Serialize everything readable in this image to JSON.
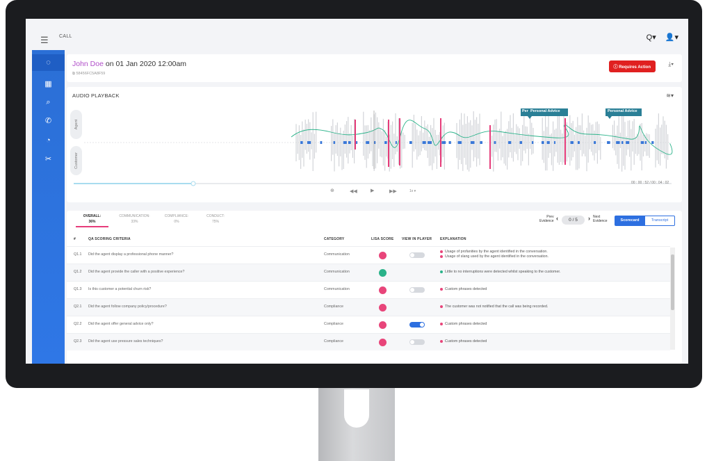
{
  "topbar": {
    "breadcrumb": "CALL",
    "menu_icon": "☰",
    "search_icon": "Q▾",
    "user_icon": "👤▾"
  },
  "sidebar": {
    "items": [
      {
        "icon": "chat-icon",
        "glyph": "◌"
      },
      {
        "icon": "dashboard-icon",
        "glyph": "▦"
      },
      {
        "icon": "search-icon",
        "glyph": "⌕"
      },
      {
        "icon": "phone-icon",
        "glyph": "✆"
      },
      {
        "icon": "pie-chart-icon",
        "glyph": "◔"
      },
      {
        "icon": "tools-icon",
        "glyph": "✂"
      }
    ]
  },
  "header": {
    "caller_name": "John Doe",
    "title_suffix": " on 01 Jan 2020 12:00am",
    "call_id": "58456FC5A8F59",
    "requires_action": "ⓘ Requires Action",
    "download_icon": "⤓▾"
  },
  "audio": {
    "title": "AUDIO PLAYBACK",
    "agent_label": "Agent",
    "customer_label": "Customer",
    "tooltip_short": "Per",
    "tooltip_1": "Personal Advice",
    "tooltip_2": "Personal Advice",
    "time": "00 : 00 : 52 / 00 : 04 : 02",
    "speed": "1x ▾",
    "progress": 0.2,
    "accent_color": "#e63c7a",
    "line_color": "#2bb38a"
  },
  "scorecard": {
    "tabs": [
      {
        "name": "OVERALL:",
        "value": "36%"
      },
      {
        "name": "COMMUNICATION:",
        "value": "33%"
      },
      {
        "name": "COMPLIANCE:",
        "value": "0%"
      },
      {
        "name": "CONDUCT:",
        "value": "75%"
      }
    ],
    "prev": "Prev",
    "next": "Next",
    "evidence": "Evidence",
    "evidence_count": "0 / 5",
    "btn_scorecard": "Scorecard",
    "btn_transcript": "Transcript",
    "headers": {
      "num": "#",
      "criteria": "QA SCORING CRITERIA",
      "category": "CATEGORY",
      "score": "LISA SCORE",
      "view": "VIEW IN PLAYER",
      "explanation": "EXPLANATION"
    },
    "rows": [
      {
        "id": "Q1.1",
        "criteria": "Did the agent display a professional phone manner?",
        "category": "Communication",
        "score": "fail",
        "toggle": "off",
        "explanation": [
          "Usage of profanities by the agent identified in the conversation.",
          "Usage of slang used by the agent identified in the conversation."
        ],
        "exp_status": [
          "fail",
          "fail"
        ]
      },
      {
        "id": "Q1.2",
        "criteria": "Did the agent provide the caller with a positive experience?",
        "category": "Communication",
        "score": "pass",
        "toggle": "none",
        "explanation": [
          "Little to no interruptions were detected whilst speaking to the customer."
        ],
        "exp_status": [
          "pass"
        ]
      },
      {
        "id": "Q1.3",
        "criteria": "Is this customer a potential churn risk?",
        "category": "Communication",
        "score": "fail",
        "toggle": "off",
        "explanation": [
          "Custom phrases detected"
        ],
        "exp_status": [
          "fail"
        ]
      },
      {
        "id": "Q2.1",
        "criteria": "Did the agent follow company policy/procedure?",
        "category": "Compliance",
        "score": "fail",
        "toggle": "none",
        "explanation": [
          "The customer was not notified that the call was being recorded."
        ],
        "exp_status": [
          "fail"
        ]
      },
      {
        "id": "Q2.2",
        "criteria": "Did the agent offer general advice only?",
        "category": "Compliance",
        "score": "fail",
        "toggle": "on",
        "explanation": [
          "Custom phrases detected"
        ],
        "exp_status": [
          "fail"
        ]
      },
      {
        "id": "Q2.3",
        "criteria": "Did the agent use pressure sales techniques?",
        "category": "Compliance",
        "score": "fail",
        "toggle": "off",
        "explanation": [
          "Custom phrases detected"
        ],
        "exp_status": [
          "fail"
        ]
      }
    ],
    "colors": {
      "fail": "#e8457a",
      "pass": "#2bb38a",
      "toggle_on": "#2d6fe0",
      "toggle_off": "#d6d9de"
    }
  }
}
